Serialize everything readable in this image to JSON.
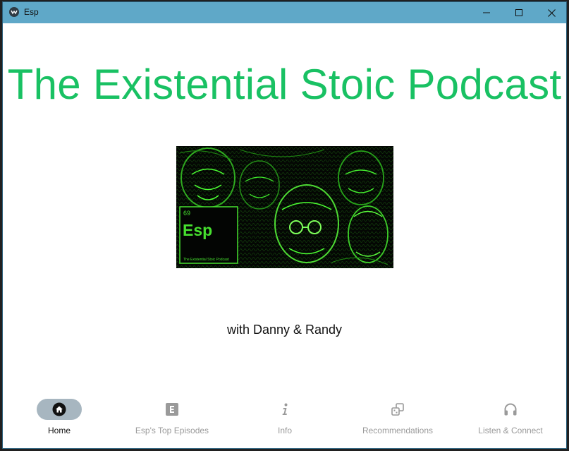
{
  "window": {
    "title": "Esp"
  },
  "main": {
    "heading": "The Existential Stoic Podcast",
    "subtitle": "with Danny & Randy",
    "cover": {
      "element_number": "69",
      "symbol": "Esp",
      "caption": "The Existential Stoic Podcast"
    }
  },
  "nav": {
    "items": [
      {
        "label": "Home",
        "icon": "home-icon",
        "active": true
      },
      {
        "label": "Esp's Top Episodes",
        "icon": "letter-e-icon",
        "active": false
      },
      {
        "label": "Info",
        "icon": "info-icon",
        "active": false
      },
      {
        "label": "Recommendations",
        "icon": "recommendations-icon",
        "active": false
      },
      {
        "label": "Listen & Connect",
        "icon": "headphones-icon",
        "active": false
      }
    ]
  },
  "colors": {
    "accent": "#19c163",
    "titlebar": "#5fa8c8",
    "active_pill": "#a7b6c0",
    "inactive_label": "#9a9a9a"
  }
}
